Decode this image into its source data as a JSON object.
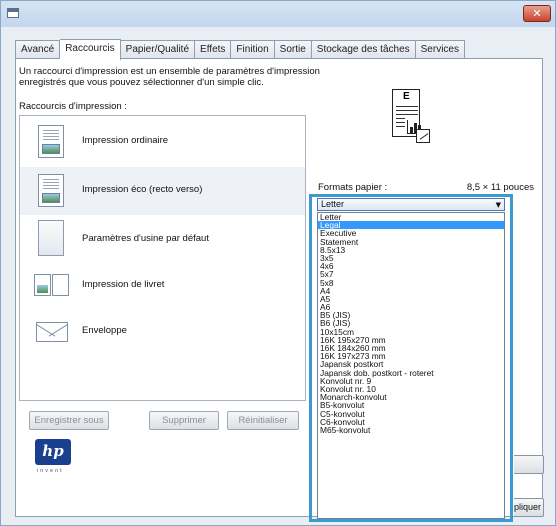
{
  "window": {
    "close_glyph": "✕"
  },
  "tabs": [
    {
      "label": "Avancé"
    },
    {
      "label": "Raccourcis"
    },
    {
      "label": "Papier/Qualité"
    },
    {
      "label": "Effets"
    },
    {
      "label": "Finition"
    },
    {
      "label": "Sortie"
    },
    {
      "label": "Stockage des tâches"
    },
    {
      "label": "Services"
    }
  ],
  "shortcuts": {
    "description": "Un raccourci d'impression est un ensemble de paramètres d'impression enregistrés que vous pouvez sélectionner d'un simple clic.",
    "list_label": "Raccourcis d'impression :",
    "items": [
      {
        "label": "Impression ordinaire",
        "icon": "document-icon"
      },
      {
        "label": "Impression éco (recto verso)",
        "icon": "duplex-document-icon"
      },
      {
        "label": "Paramètres d'usine par défaut",
        "icon": "blank-page-icon"
      },
      {
        "label": "Impression de livret",
        "icon": "booklet-icon"
      },
      {
        "label": "Enveloppe",
        "icon": "envelope-icon"
      }
    ],
    "buttons": {
      "save_as": "Enregistrer sous",
      "delete": "Supprimer",
      "reset": "Réinitialiser"
    }
  },
  "brand": {
    "logo_text": "hp",
    "tagline": "invent"
  },
  "paper": {
    "label": "Formats papier :",
    "size_readout": "8,5 × 11 pouces",
    "selected": "Letter",
    "options": [
      "Letter",
      "Legal",
      "Executive",
      "Statement",
      "8.5x13",
      "3x5",
      "4x6",
      "5x7",
      "5x8",
      "A4",
      "A5",
      "A6",
      "B5 (JIS)",
      "B6 (JIS)",
      "10x15cm",
      "16K 195x270 mm",
      "16K 184x260 mm",
      "16K 197x273 mm",
      "Japansk postkort",
      "Japansk dob. postkort - roteret",
      "Konvolut nr. 9",
      "Konvolut nr. 10",
      "Monarch-konvolut",
      "B5-konvolut",
      "C5-konvolut",
      "C6-konvolut",
      "M65-konvolut"
    ],
    "highlighted": "Legal"
  },
  "side_buttons": {
    "apply_partial": "pliquer"
  }
}
